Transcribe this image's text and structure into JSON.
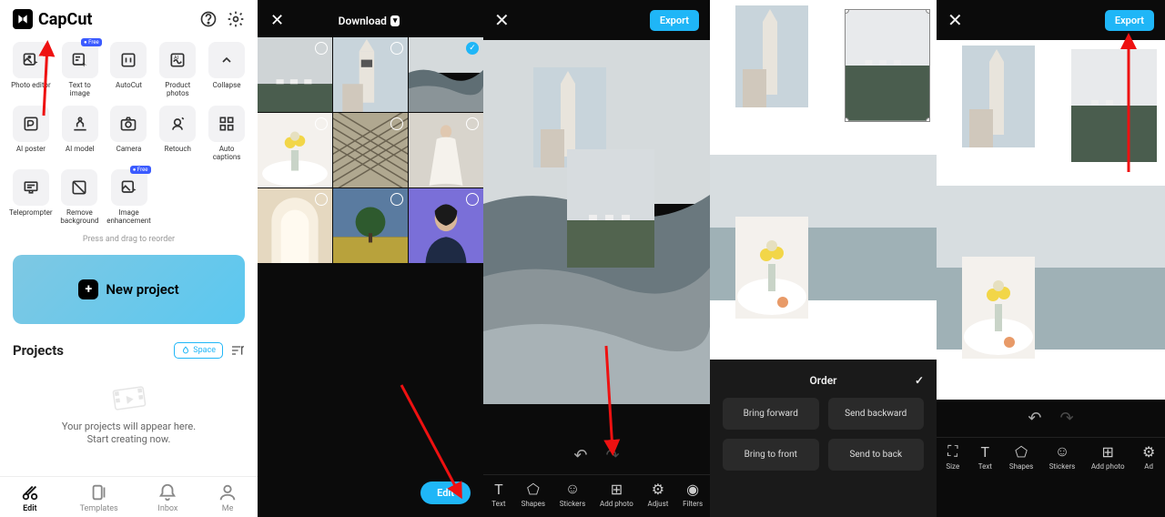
{
  "app": {
    "name": "CapCut"
  },
  "panel1": {
    "tools_row1": [
      {
        "label": "Photo editor",
        "icon": "image-edit"
      },
      {
        "label": "Text to image",
        "icon": "text-image",
        "free": true
      },
      {
        "label": "AutoCut",
        "icon": "autocut"
      },
      {
        "label": "Product photos",
        "icon": "product"
      },
      {
        "label": "Collapse",
        "icon": "chevron-up"
      }
    ],
    "tools_row2": [
      {
        "label": "AI poster",
        "icon": "poster"
      },
      {
        "label": "AI model",
        "icon": "aimodel"
      },
      {
        "label": "Camera",
        "icon": "camera"
      },
      {
        "label": "Retouch",
        "icon": "retouch"
      },
      {
        "label": "Auto captions",
        "icon": "captions"
      }
    ],
    "tools_row3": [
      {
        "label": "Teleprompter",
        "icon": "teleprompter"
      },
      {
        "label": "Remove background",
        "icon": "removebg"
      },
      {
        "label": "Image enhancement",
        "icon": "enhance",
        "free": true
      }
    ],
    "reorder_hint": "Press and drag to reorder",
    "new_project": "New project",
    "projects_title": "Projects",
    "space_btn": "Space",
    "empty_line1": "Your projects will appear here.",
    "empty_line2": "Start creating now.",
    "nav": [
      {
        "label": "Edit",
        "active": true
      },
      {
        "label": "Templates",
        "active": false
      },
      {
        "label": "Inbox",
        "active": false
      },
      {
        "label": "Me",
        "active": false
      }
    ]
  },
  "panel2": {
    "download": "Download",
    "edit": "Edit",
    "thumbs": [
      {
        "selected": false,
        "kind": "ocean"
      },
      {
        "selected": false,
        "kind": "church"
      },
      {
        "selected": true,
        "kind": "wave"
      },
      {
        "selected": false,
        "kind": "flowers"
      },
      {
        "selected": false,
        "kind": "pattern"
      },
      {
        "selected": false,
        "kind": "dress"
      },
      {
        "selected": false,
        "kind": "tunnel"
      },
      {
        "selected": false,
        "kind": "tree"
      },
      {
        "selected": false,
        "kind": "portrait"
      }
    ]
  },
  "panel3": {
    "export": "Export",
    "toolbar": [
      {
        "label": "Text",
        "icon": "text"
      },
      {
        "label": "Shapes",
        "icon": "shapes"
      },
      {
        "label": "Stickers",
        "icon": "stickers"
      },
      {
        "label": "Add photo",
        "icon": "addphoto"
      },
      {
        "label": "Adjust",
        "icon": "adjust"
      },
      {
        "label": "Filters",
        "icon": "filters"
      }
    ]
  },
  "panel4": {
    "order_title": "Order",
    "buttons": [
      "Bring forward",
      "Send backward",
      "Bring to front",
      "Send to back"
    ]
  },
  "panel5": {
    "export": "Export",
    "toolbar": [
      {
        "label": "Size",
        "icon": "size"
      },
      {
        "label": "Text",
        "icon": "text"
      },
      {
        "label": "Shapes",
        "icon": "shapes"
      },
      {
        "label": "Stickers",
        "icon": "stickers"
      },
      {
        "label": "Add photo",
        "icon": "addphoto"
      },
      {
        "label": "Ad",
        "icon": "adjust"
      }
    ]
  }
}
